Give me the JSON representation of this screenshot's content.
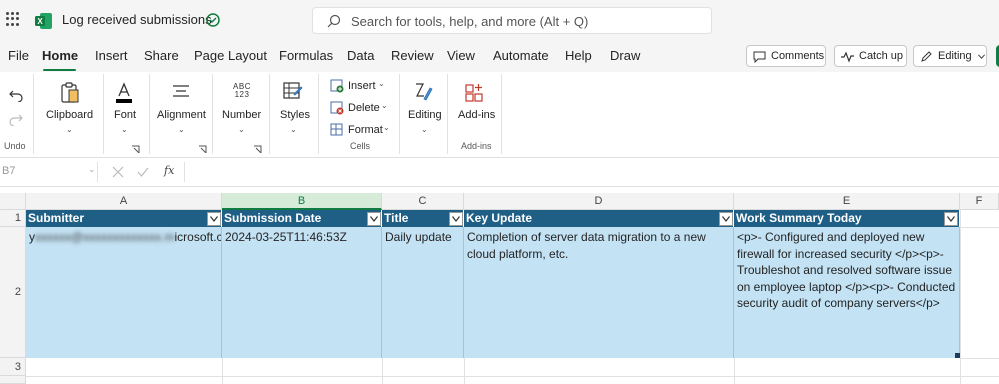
{
  "app": {
    "doc_title": "Log received submissions",
    "search_placeholder": "Search for tools, help, and more (Alt + Q)"
  },
  "tabs": [
    {
      "label": "File"
    },
    {
      "label": "Home",
      "active": true
    },
    {
      "label": "Insert"
    },
    {
      "label": "Share"
    },
    {
      "label": "Page Layout"
    },
    {
      "label": "Formulas"
    },
    {
      "label": "Data"
    },
    {
      "label": "Review"
    },
    {
      "label": "View"
    },
    {
      "label": "Automate"
    },
    {
      "label": "Help"
    },
    {
      "label": "Draw"
    }
  ],
  "top_buttons": {
    "comments": "Comments",
    "catch_up": "Catch up",
    "editing": "Editing"
  },
  "ribbon": {
    "undo_label": "Undo",
    "clipboard": "Clipboard",
    "font": "Font",
    "alignment": "Alignment",
    "number": "Number",
    "number_icon_text": "ABC\n123",
    "styles": "Styles",
    "insert": "Insert",
    "delete": "Delete",
    "format": "Format",
    "cells": "Cells",
    "editing": "Editing",
    "addins": "Add-ins",
    "addins_group": "Add-ins"
  },
  "formula_bar": {
    "name_box": "B7",
    "fx": "fx"
  },
  "grid": {
    "columns": [
      "A",
      "B",
      "C",
      "D",
      "E",
      "F"
    ],
    "rows": [
      "1",
      "2",
      "3"
    ],
    "headers": [
      "Submitter",
      "Submission Date",
      "Title",
      "Key Update",
      "Work Summary Today"
    ],
    "row2": {
      "submitter_prefix": "y",
      "submitter_suffix": "icrosoft.com",
      "submission_date": "2024-03-25T11:46:53Z",
      "title": "Daily update",
      "key_update": "Completion of server data migration to a new cloud platform, etc.",
      "work_summary": "<p>- Configured and deployed new firewall for increased security </p><p>- Troubleshot and resolved software issue on employee laptop </p><p>- Conducted security audit of company servers</p>"
    }
  },
  "colors": {
    "accent": "#107c41",
    "table_header": "#1f5f86",
    "table_row": "#c3e2f4"
  }
}
